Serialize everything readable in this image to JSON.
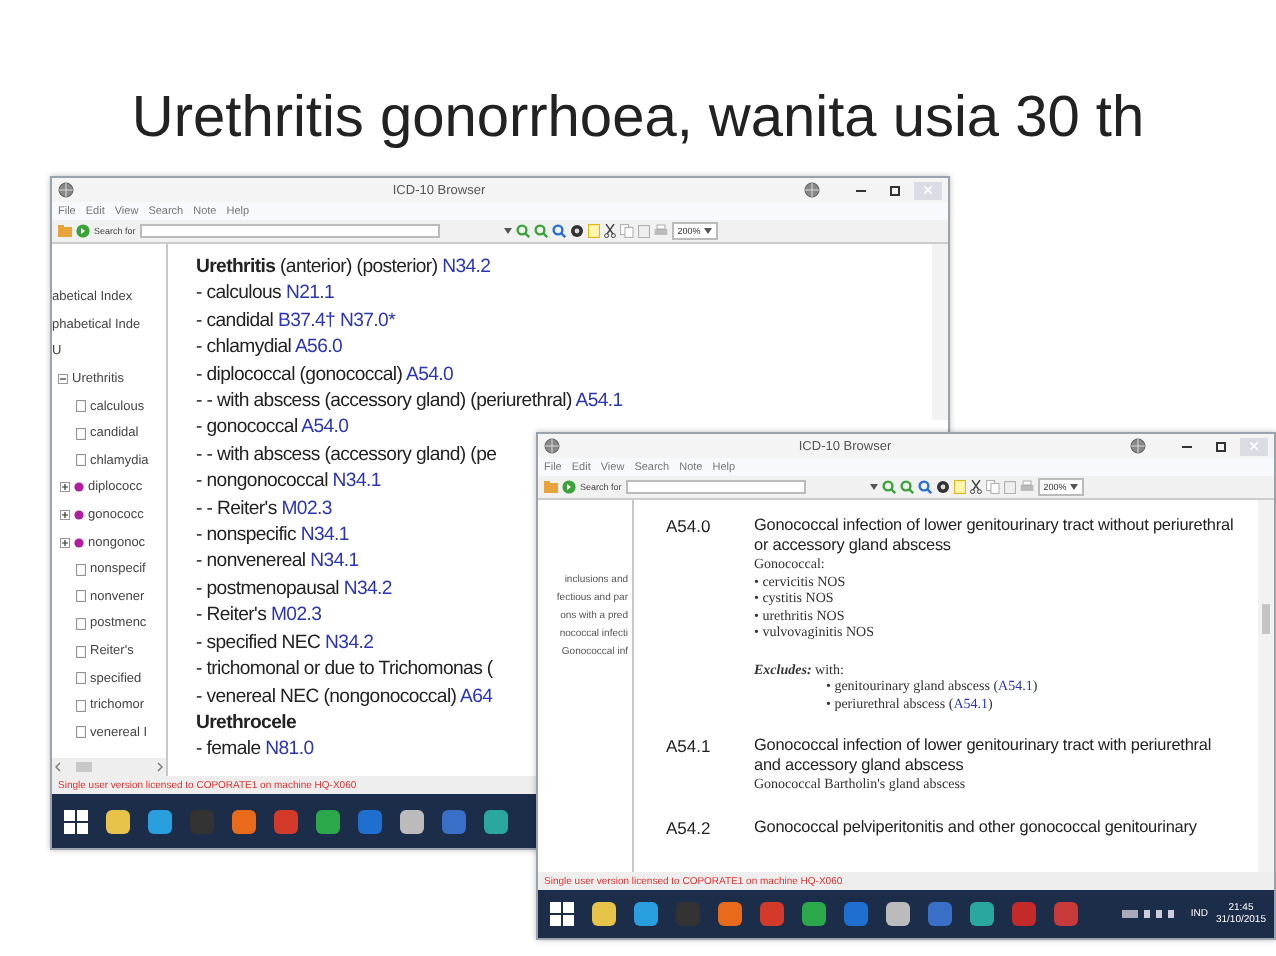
{
  "slide_title": "Urethritis gonorrhoea, wanita usia 30 th",
  "windows": [
    {
      "kind": "index",
      "title": "ICD-10 Browser",
      "menu": [
        "File",
        "Edit",
        "View",
        "Search",
        "Note",
        "Help"
      ],
      "search_label": "Search for",
      "zoom": "200%",
      "tree": [
        {
          "kind": "text",
          "label": "abetical Index"
        },
        {
          "kind": "text",
          "label": "phabetical Inde"
        },
        {
          "kind": "text",
          "label": "U"
        },
        {
          "kind": "branch",
          "label": "Urethritis",
          "expanded": true,
          "children": [
            {
              "kind": "leaf",
              "label": "calculous"
            },
            {
              "kind": "leaf",
              "label": "candidal"
            },
            {
              "kind": "leaf",
              "label": "chlamydia"
            },
            {
              "kind": "branch",
              "label": "diplococc",
              "expanded": false
            },
            {
              "kind": "branch",
              "label": "gonococc",
              "expanded": false
            },
            {
              "kind": "branch",
              "label": "nongonoc",
              "expanded": false
            },
            {
              "kind": "leaf",
              "label": "nonspecif"
            },
            {
              "kind": "leaf",
              "label": "nonvener"
            },
            {
              "kind": "leaf",
              "label": "postmenc"
            },
            {
              "kind": "leaf",
              "label": "Reiter's"
            },
            {
              "kind": "leaf",
              "label": "specified"
            },
            {
              "kind": "leaf",
              "label": "trichomor"
            },
            {
              "kind": "leaf",
              "label": "venereal I"
            }
          ]
        }
      ],
      "index_lines": [
        {
          "kind": "heading",
          "term": "Urethritis",
          "text": "(anterior) (posterior)",
          "codes": [
            "N34.2"
          ]
        },
        {
          "kind": "entry",
          "text": "- calculous",
          "codes": [
            "N21.1"
          ]
        },
        {
          "kind": "entry",
          "text": "- candidal",
          "codes": [
            "B37.4†",
            "N37.0*"
          ]
        },
        {
          "kind": "entry",
          "text": "- chlamydial",
          "codes": [
            "A56.0"
          ]
        },
        {
          "kind": "entry",
          "text": "- diplococcal (gonococcal)",
          "codes": [
            "A54.0"
          ]
        },
        {
          "kind": "entry",
          "text": "- - with abscess (accessory gland) (periurethral)",
          "codes": [
            "A54.1"
          ]
        },
        {
          "kind": "entry",
          "text": "- gonococcal",
          "codes": [
            "A54.0"
          ]
        },
        {
          "kind": "entry",
          "text": "- - with abscess (accessory gland) (pe"
        },
        {
          "kind": "entry",
          "text": "- nongonococcal",
          "codes": [
            "N34.1"
          ]
        },
        {
          "kind": "entry",
          "text": "- - Reiter's",
          "codes": [
            "M02.3"
          ]
        },
        {
          "kind": "entry",
          "text": "- nonspecific",
          "codes": [
            "N34.1"
          ]
        },
        {
          "kind": "entry",
          "text": "- nonvenereal",
          "codes": [
            "N34.1"
          ]
        },
        {
          "kind": "entry",
          "text": "- postmenopausal",
          "codes": [
            "N34.2"
          ]
        },
        {
          "kind": "entry",
          "text": "- Reiter's",
          "codes": [
            "M02.3"
          ]
        },
        {
          "kind": "entry",
          "text": "- specified NEC",
          "codes": [
            "N34.2"
          ]
        },
        {
          "kind": "entry",
          "text": "- trichomonal or due to Trichomonas ("
        },
        {
          "kind": "entry",
          "text": "- venereal NEC (nongonococcal)",
          "codes": [
            "A64"
          ]
        },
        {
          "kind": "heading",
          "term": "Urethrocele"
        },
        {
          "kind": "entry",
          "text": "- female",
          "codes": [
            "N81.0"
          ]
        }
      ],
      "status": "Single user version licensed to COPORATE1 on machine HQ-X060"
    },
    {
      "kind": "tabular",
      "title": "ICD-10 Browser",
      "menu": [
        "File",
        "Edit",
        "View",
        "Search",
        "Note",
        "Help"
      ],
      "search_label": "Search for",
      "zoom": "200%",
      "side_texts": [
        "inclusions and",
        "fectious and par",
        "ons with a pred",
        "nococcal infecti",
        "Gonococcal inf"
      ],
      "entries": [
        {
          "code": "A54.0",
          "title": "Gonococcal infection of lower genitourinary tract without periurethral or accessory gland abscess",
          "notes": [
            "Gonococcal:",
            "• cervicitis NOS",
            "• cystitis NOS",
            "• urethritis NOS",
            "• vulvovaginitis NOS"
          ],
          "excludes": {
            "label": "Excludes:",
            "text": "with:",
            "items": [
              {
                "before": "• genitourinary gland abscess (",
                "ref": "A54.1",
                "after": ")"
              },
              {
                "before": "• periurethral abscess (",
                "ref": "A54.1",
                "after": ")"
              }
            ]
          }
        },
        {
          "code": "A54.1",
          "title": "Gonococcal infection of lower genitourinary tract with periurethral and accessory gland abscess",
          "notes": [
            "Gonococcal Bartholin's gland abscess"
          ]
        },
        {
          "code": "A54.2",
          "title": "Gonococcal pelviperitonitis and other gonococcal genitourinary"
        }
      ],
      "status": "Single user version licensed to COPORATE1 on machine HQ-X060",
      "tray": {
        "language": "IND",
        "time": "21:45",
        "date": "31/10/2015"
      }
    }
  ]
}
